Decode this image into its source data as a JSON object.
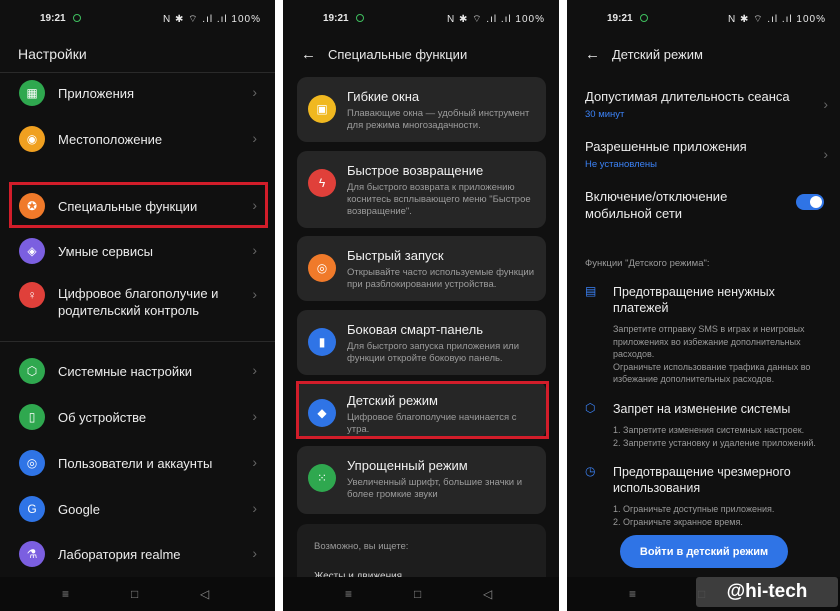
{
  "status": {
    "time": "19:21",
    "icons": "N ✱ ⌔ .ıl .ıl",
    "battery": "100%"
  },
  "navbar": {
    "menu": "≡",
    "home": "□",
    "back": "◁"
  },
  "panel1": {
    "title": "Настройки",
    "items": [
      {
        "label": "Приложения",
        "icon": "apps-icon",
        "color": "#2fa84f",
        "glyph": "▦"
      },
      {
        "label": "Местоположение",
        "icon": "location-icon",
        "color": "#f0a020",
        "glyph": "◉"
      },
      {
        "label": "Специальные функции",
        "icon": "accessibility-icon",
        "color": "#f07a2a",
        "glyph": "✪"
      },
      {
        "label": "Умные сервисы",
        "icon": "smart-services-icon",
        "color": "#7b5fe0",
        "glyph": "◈"
      },
      {
        "label": "Цифровое благополучие и родительский контроль",
        "icon": "wellbeing-icon",
        "color": "#e0403a",
        "glyph": "♀"
      },
      {
        "label": "Системные настройки",
        "icon": "system-icon",
        "color": "#2fa84f",
        "glyph": "⬡"
      },
      {
        "label": "Об устройстве",
        "icon": "device-icon",
        "color": "#2fa84f",
        "glyph": "▯"
      },
      {
        "label": "Пользователи и аккаунты",
        "icon": "users-icon",
        "color": "#2f74e6",
        "glyph": "◎"
      },
      {
        "label": "Google",
        "icon": "google-icon",
        "color": "#2f74e6",
        "glyph": "G"
      },
      {
        "label": "Лаборатория realme",
        "icon": "lab-icon",
        "color": "#7b5fe0",
        "glyph": "⚗"
      }
    ]
  },
  "panel2": {
    "title": "Специальные функции",
    "cards": [
      {
        "title": "Гибкие окна",
        "desc": "Плавающие окна — удобный инструмент для режима многозадачности.",
        "icon": "flex-windows-icon",
        "color": "#f0b820",
        "glyph": "▣"
      },
      {
        "title": "Быстрое возвращение",
        "desc": "Для быстрого возврата к приложению коснитесь всплывающего меню \"Быстрое возвращение\".",
        "icon": "quick-return-icon",
        "color": "#e0403a",
        "glyph": "ϟ"
      },
      {
        "title": "Быстрый запуск",
        "desc": "Открывайте часто используемые функции при разблокировании устройства.",
        "icon": "quick-launch-icon",
        "color": "#f07a2a",
        "glyph": "◎"
      },
      {
        "title": "Боковая смарт-панель",
        "desc": "Для быстрого запуска приложения или функции откройте боковую панель.",
        "icon": "side-panel-icon",
        "color": "#2f74e6",
        "glyph": "▮"
      },
      {
        "title": "Детский режим",
        "desc": "Цифровое благополучие начинается с утра.",
        "icon": "kid-mode-icon",
        "color": "#2f74e6",
        "glyph": "◆"
      },
      {
        "title": "Упрощенный режим",
        "desc": "Увеличенный шрифт, большие значки и более громкие звуки",
        "icon": "simple-mode-icon",
        "color": "#2fa84f",
        "glyph": "⁙"
      }
    ],
    "maybe_header": "Возможно, вы ищете:",
    "maybe_item": "Жесты и движения"
  },
  "panel3": {
    "title": "Детский режим",
    "session_title": "Допустимая длительность сеанса",
    "session_value": "30 минут",
    "apps_title": "Разрешенные приложения",
    "apps_value": "Не установлены",
    "network_title": "Включение/отключение мобильной сети",
    "network_enabled": true,
    "section": "Функции \"Детского режима\":",
    "features": [
      {
        "title": "Предотвращение ненужных платежей",
        "desc": "Запретите отправку SMS в играх и неигровых приложениях во избежание дополнительных расходов.\nОграничьте использование трафика данных во избежание дополнительных расходов.",
        "icon": "message-icon",
        "glyph": "▤"
      },
      {
        "title": "Запрет на изменение системы",
        "desc": "1. Запретите изменения системных настроек.\n2. Запретите установку и удаление приложений.",
        "icon": "shield-icon",
        "glyph": "⬡"
      },
      {
        "title": "Предотвращение чрезмерного использования",
        "desc": "1. Ограничьте доступные приложения.\n2. Ограничьте экранное время.",
        "icon": "clock-icon",
        "glyph": "◷"
      }
    ],
    "button": "Войти в детский режим"
  },
  "watermark": "@hi-tech"
}
